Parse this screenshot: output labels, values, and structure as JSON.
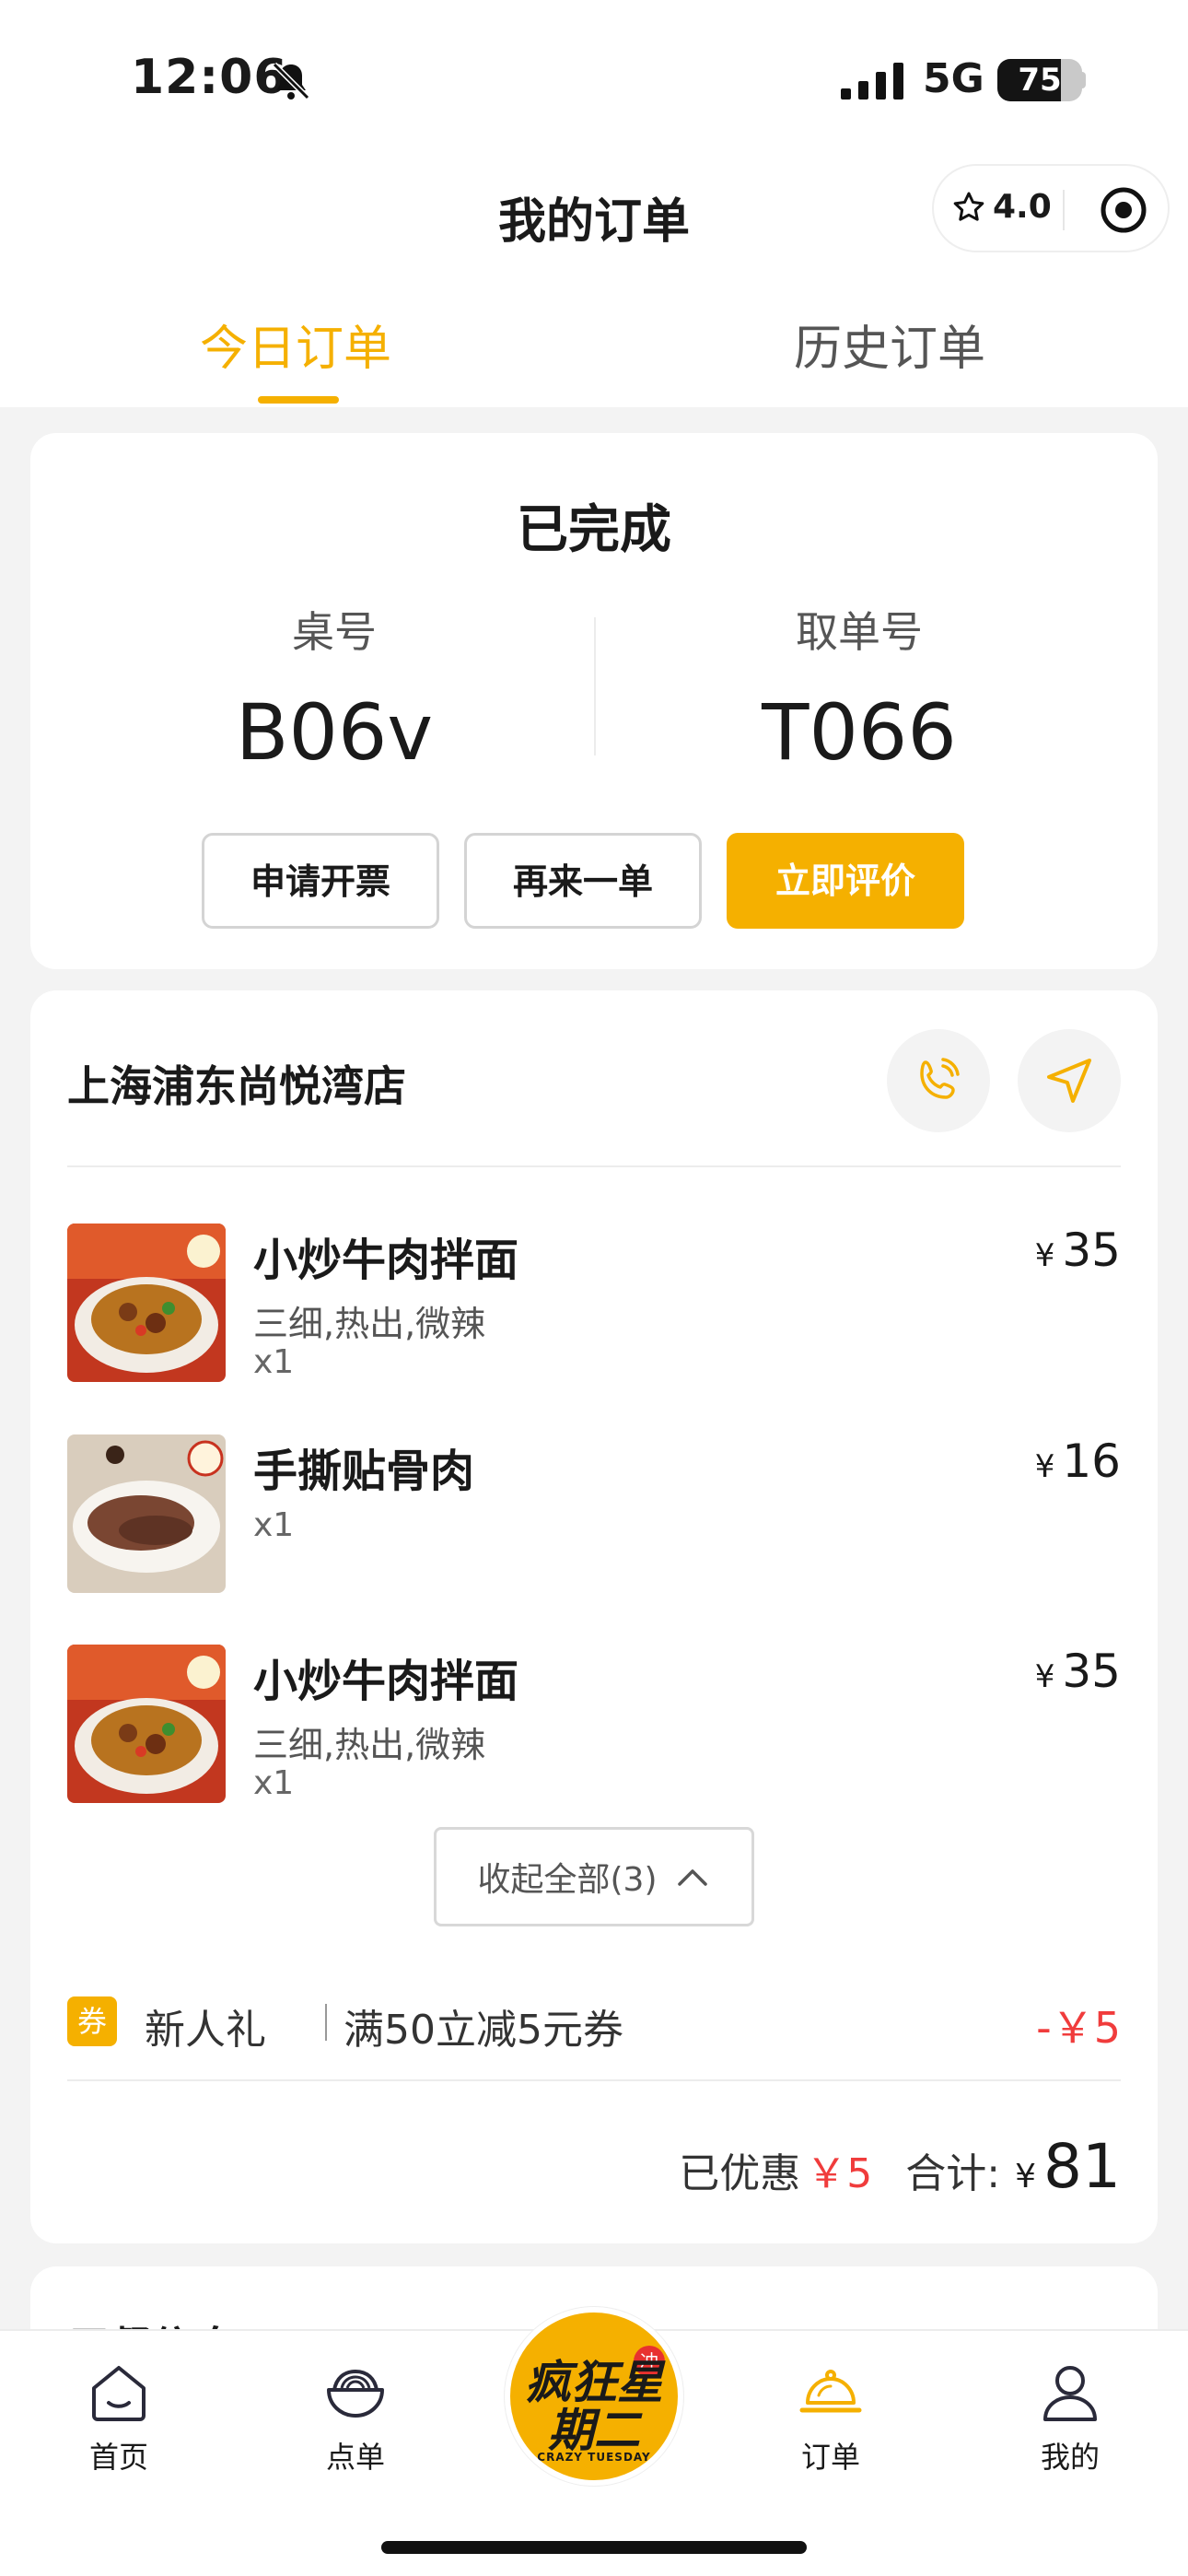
{
  "status_bar": {
    "time": "12:06",
    "network": "5G",
    "battery": "75",
    "battery_level": 0.75
  },
  "header": {
    "title": "我的订单",
    "rating": "4.0"
  },
  "tabs": [
    {
      "label": "今日订单",
      "active": true
    },
    {
      "label": "历史订单",
      "active": false
    }
  ],
  "order_status": {
    "title": "已完成",
    "table_label": "桌号",
    "table_value": "B06v",
    "pickup_label": "取单号",
    "pickup_value": "T066",
    "buttons": {
      "invoice": "申请开票",
      "reorder": "再来一单",
      "review": "立即评价"
    }
  },
  "store": {
    "name": "上海浦东尚悦湾店",
    "items": [
      {
        "name": "小炒牛肉拌面",
        "spec": "三细,热出,微辣",
        "qty": "x1",
        "currency": "¥",
        "price": "35"
      },
      {
        "name": "手撕贴骨肉",
        "spec": "",
        "qty": "x1",
        "currency": "¥",
        "price": "16"
      },
      {
        "name": "小炒牛肉拌面",
        "spec": "三细,热出,微辣",
        "qty": "x1",
        "currency": "¥",
        "price": "35"
      }
    ],
    "collapse_label": "收起全部(3)",
    "coupon": {
      "badge": "券",
      "name": "新人礼",
      "desc": "满50立减5元券",
      "amount": "-￥5"
    },
    "discount_label": "已优惠",
    "discount_value": "￥5",
    "total_label": "合计:",
    "total_currency": "¥",
    "total_value": "81"
  },
  "dining_info": {
    "title": "用餐信息"
  },
  "tabbar": {
    "items": [
      "首页",
      "点单",
      "订单",
      "我的"
    ],
    "logo_text": "疯狂星期二",
    "logo_sub": "CRAZY TUESDAY",
    "logo_badge": "冲"
  },
  "colors": {
    "accent": "#f5b000",
    "price_red": "#f03c3c"
  }
}
